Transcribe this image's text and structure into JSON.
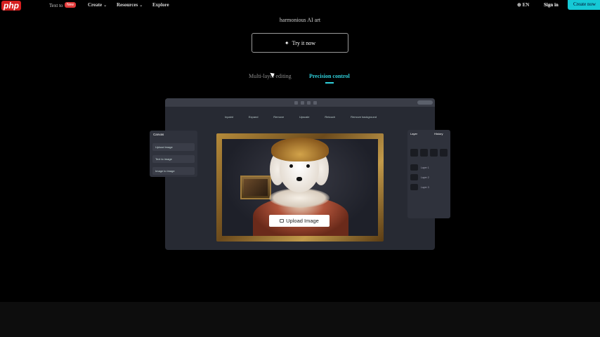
{
  "nav": {
    "brand": "php",
    "brand_sub": "Text to",
    "new_badge": "New",
    "create": "Create",
    "resources": "Resources",
    "explore": "Explore",
    "lang": "EN",
    "sign_in": "Sign in",
    "create_now": "Create now"
  },
  "hero": {
    "tagline": "harmonious AI art",
    "try_label": "Try it now"
  },
  "tabs": {
    "multi": "Multi-layer editing",
    "precision": "Precision control"
  },
  "preview": {
    "toolbar": [
      "Inpaint",
      "Expand",
      "Remove",
      "Upscale",
      "Retouch",
      "Remove background"
    ],
    "left_panel": {
      "title": "Canvas",
      "items": [
        "Upload image",
        "Text to image",
        "Image to image"
      ]
    },
    "right_panel": {
      "title": "Layer",
      "history": "History",
      "layers": [
        "Layer 1",
        "Layer 2",
        "Layer 3"
      ]
    },
    "upload_label": "Upload Image"
  },
  "colors": {
    "accent": "#16c9d6",
    "badge": "#e23a3a"
  }
}
